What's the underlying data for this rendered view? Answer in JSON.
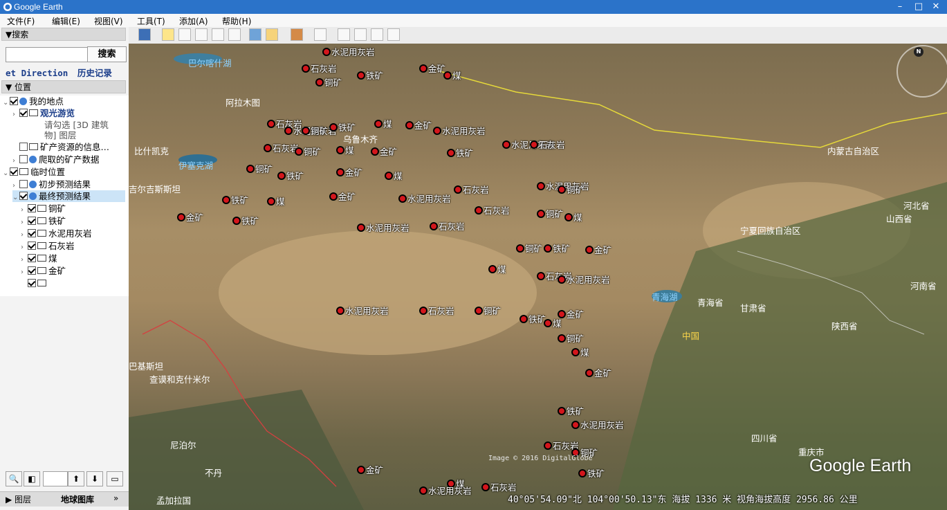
{
  "app": {
    "title": "Google Earth"
  },
  "window_controls": {
    "minimize": "–",
    "maximize": "□",
    "close": "✕"
  },
  "menu": [
    "文件(F)",
    "编辑(E)",
    "视图(V)",
    "工具(T)",
    "添加(A)",
    "帮助(H)"
  ],
  "search_panel": {
    "header": "▼搜索",
    "input_value": "",
    "button": "搜索",
    "link_direction": "et Direction",
    "link_history": "历史记录"
  },
  "places_panel": {
    "header": "▼ 位置",
    "items": [
      {
        "label": "我的地点"
      },
      {
        "label": "观光游览"
      },
      {
        "label": "请勾选 [3D 建筑"
      },
      {
        "label": "物] 图层"
      },
      {
        "label": "矿产资源的信息…"
      },
      {
        "label": "爬取的矿产数据"
      },
      {
        "label": "临时位置"
      },
      {
        "label": "初步预测结果"
      },
      {
        "label": "最终预测结果"
      },
      {
        "label": "铜矿"
      },
      {
        "label": "铁矿"
      },
      {
        "label": "水泥用灰岩"
      },
      {
        "label": "石灰岩"
      },
      {
        "label": "煤"
      },
      {
        "label": "金矿"
      },
      {
        "label": ""
      }
    ]
  },
  "bottom_tabs": {
    "layers": "▶ 图层",
    "gallery": "地球图库",
    "more": "»"
  },
  "map": {
    "region_labels": [
      "巴尔喀什湖",
      "阿拉木图",
      "乌鲁木齐",
      "伊塞克湖",
      "吉尔吉斯斯坦",
      "比什凯克",
      "内蒙古自治区",
      "宁夏回族自治区",
      "河北省",
      "山西省",
      "河南省",
      "青海湖",
      "青海省",
      "甘肃省",
      "陕西省",
      "中国",
      "四川省",
      "重庆市",
      "巴基斯坦",
      "查谟和克什米尔",
      "尼泊尔",
      "不丹",
      "孟加拉国"
    ],
    "mineral_markers": [
      "水泥用灰岩",
      "石灰岩",
      "铜矿",
      "铁矿",
      "金矿",
      "煤",
      "石灰岩",
      "水泥用灰岩",
      "铜矿",
      "铁矿",
      "煤",
      "金矿",
      "水泥用灰岩",
      "石灰岩",
      "铜矿",
      "煤",
      "金矿",
      "铁矿"
    ],
    "attribution": "Image © 2016 DigitalGlobe",
    "logo": "Google Earth",
    "status": {
      "lat": "40°05'54.09\"北",
      "lon": "104°00'50.13\"东",
      "elevation_label": "海拔",
      "elevation": "1336 米",
      "eye_label": "视角海拔高度",
      "eye_alt": "2956.86 公里"
    }
  },
  "colors": {
    "titlebar": "#2b73c9",
    "marker": "#d3161c",
    "label": "#ffffff"
  }
}
